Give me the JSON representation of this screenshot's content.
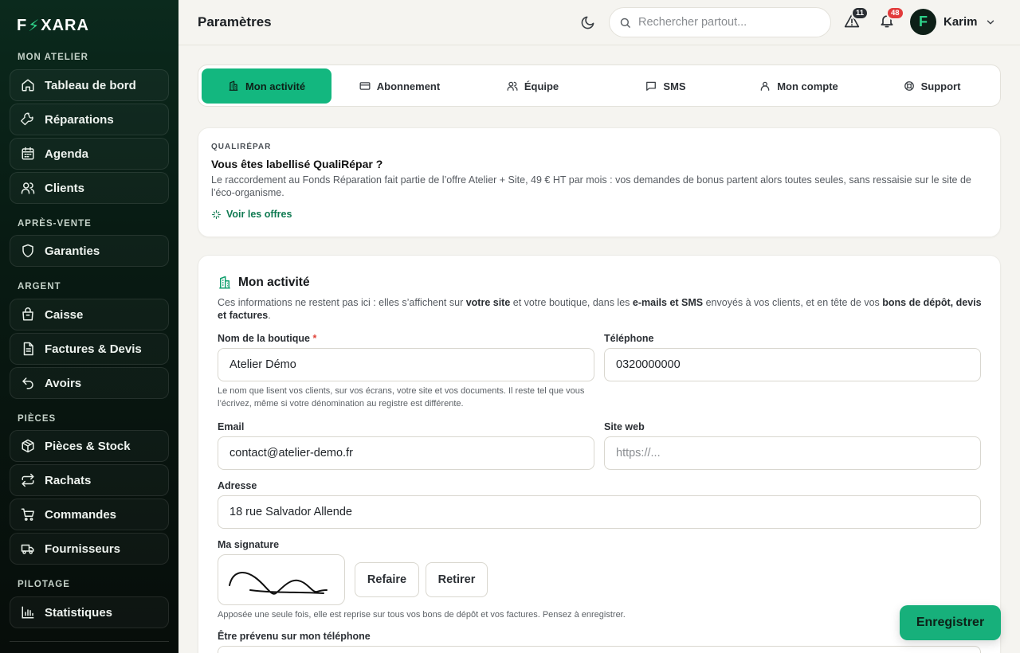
{
  "app": {
    "logo_left": "F",
    "logo_bolt": "⚡",
    "logo_right": "XARA",
    "brand_color": "#13b77f"
  },
  "sidebar": {
    "sections": [
      {
        "title": "MON ATELIER",
        "items": [
          {
            "label": "Tableau de bord",
            "icon": "home-icon"
          },
          {
            "label": "Réparations",
            "icon": "wrench-icon"
          },
          {
            "label": "Agenda",
            "icon": "calendar-icon"
          },
          {
            "label": "Clients",
            "icon": "users-icon"
          }
        ]
      },
      {
        "title": "APRÈS-VENTE",
        "items": [
          {
            "label": "Garanties",
            "icon": "shield-icon"
          }
        ]
      },
      {
        "title": "ARGENT",
        "items": [
          {
            "label": "Caisse",
            "icon": "cash-register-icon"
          },
          {
            "label": "Factures & Devis",
            "icon": "document-icon"
          },
          {
            "label": "Avoirs",
            "icon": "undo-icon"
          }
        ]
      },
      {
        "title": "PIÈCES",
        "items": [
          {
            "label": "Pièces & Stock",
            "icon": "box-icon"
          },
          {
            "label": "Rachats",
            "icon": "exchange-icon"
          },
          {
            "label": "Commandes",
            "icon": "cart-icon"
          },
          {
            "label": "Fournisseurs",
            "icon": "truck-icon"
          }
        ]
      },
      {
        "title": "PILOTAGE",
        "items": [
          {
            "label": "Statistiques",
            "icon": "bar-chart-icon"
          }
        ]
      }
    ]
  },
  "header": {
    "title": "Paramètres",
    "search_placeholder": "Rechercher partout...",
    "alerts_count": "11",
    "notifications_count": "48",
    "user_initial": "F",
    "user_name": "Karim"
  },
  "tabs": [
    {
      "label": "Mon activité",
      "icon": "building-icon",
      "active": true
    },
    {
      "label": "Abonnement",
      "icon": "card-icon",
      "active": false
    },
    {
      "label": "Équipe",
      "icon": "team-icon",
      "active": false
    },
    {
      "label": "SMS",
      "icon": "message-icon",
      "active": false
    },
    {
      "label": "Mon compte",
      "icon": "user-icon",
      "active": false
    },
    {
      "label": "Support",
      "icon": "lifebuoy-icon",
      "active": false
    }
  ],
  "qualirepar": {
    "kicker": "QUALIRÉPAR",
    "title": "Vous êtes labellisé QualiRépar ?",
    "text": "Le raccordement au Fonds Réparation fait partie de l’offre Atelier + Site, 49 € HT par mois : vos demandes de bonus partent alors toutes seules, sans ressaisie sur le site de l’éco-organisme.",
    "link": "Voir les offres"
  },
  "activity": {
    "title": "Mon activité",
    "desc": {
      "p1": "Ces informations ne restent pas ici : elles s’affichent sur ",
      "b1": "votre site",
      "p2": " et votre boutique, dans les ",
      "b2": "e-mails et SMS",
      "p3": " envoyés à vos clients, et en tête de vos ",
      "b3": "bons de dépôt, devis et factures",
      "p4": "."
    },
    "shop_name": {
      "label": "Nom de la boutique",
      "required_mark": "*",
      "value": "Atelier Démo",
      "help": "Le nom que lisent vos clients, sur vos écrans, votre site et vos documents. Il reste tel que vous l’écrivez, même si votre dénomination au registre est différente."
    },
    "phone": {
      "label": "Téléphone",
      "value": "0320000000"
    },
    "email": {
      "label": "Email",
      "value": "contact@atelier-demo.fr"
    },
    "website": {
      "label": "Site web",
      "value": "",
      "placeholder": "https://..."
    },
    "address": {
      "label": "Adresse",
      "value": "18 rue Salvador Allende"
    },
    "signature": {
      "label": "Ma signature",
      "redo": "Refaire",
      "remove": "Retirer",
      "help": "Apposée une seule fois, elle est reprise sur tous vos bons de dépôt et vos factures. Pensez à enregistrer."
    },
    "notify_label": "Être prévenu sur mon téléphone"
  },
  "save_label": "Enregistrer"
}
